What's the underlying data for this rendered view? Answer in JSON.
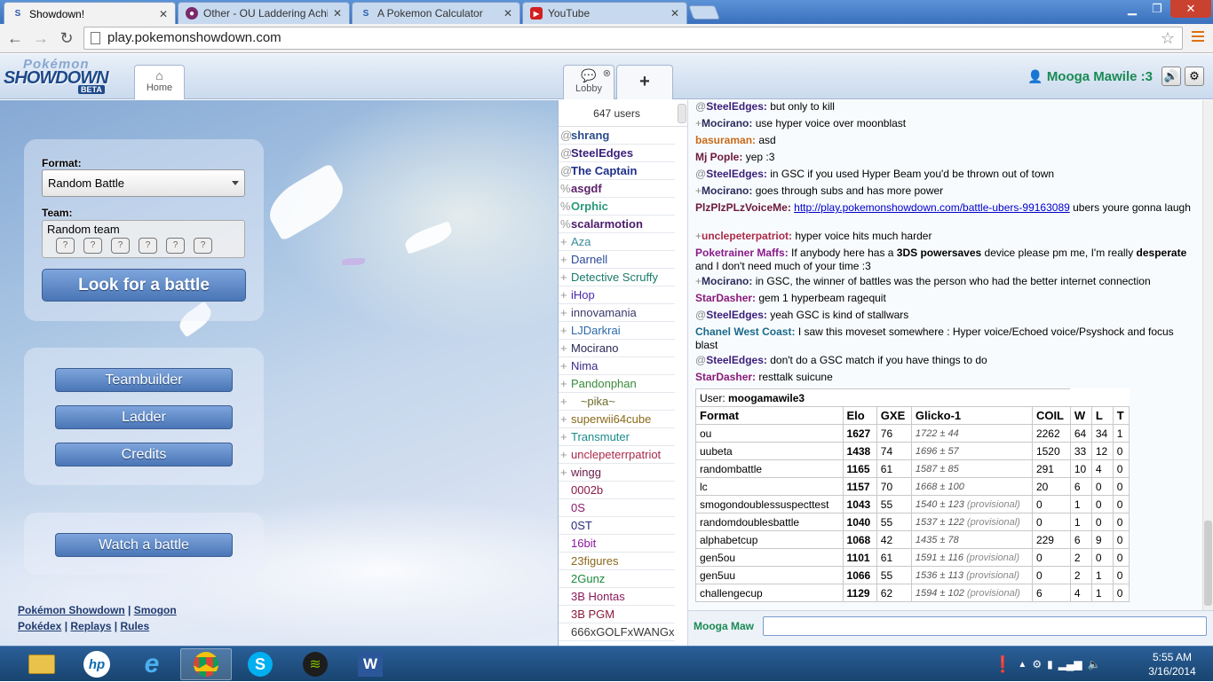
{
  "browser": {
    "tabs": [
      {
        "label": "Showdown!",
        "icon": "ps-favicon",
        "active": true
      },
      {
        "label": "Other - OU Laddering Achi",
        "icon": "forum-favicon",
        "active": false
      },
      {
        "label": "A Pokemon Calculator",
        "icon": "ps-favicon",
        "active": false
      },
      {
        "label": "YouTube",
        "icon": "youtube-favicon",
        "active": false
      }
    ],
    "url": "play.pokemonshowdown.com"
  },
  "header": {
    "logo": {
      "line1": "Pokémon",
      "line2": "SHOWDOWN",
      "badge": "BETA"
    },
    "tabs": [
      {
        "label": "Home",
        "icon": "home-icon"
      },
      {
        "label": "Lobby",
        "icon": "chat-bubble-icon"
      }
    ],
    "new_tab_label": "+",
    "username": "Mooga Mawile :3"
  },
  "home": {
    "format_label": "Format:",
    "format_value": "Random Battle",
    "team_label": "Team:",
    "team_value": "Random team",
    "look_button": "Look for a battle",
    "teambuilder_button": "Teambuilder",
    "ladder_button": "Ladder",
    "credits_button": "Credits",
    "watch_button": "Watch a battle",
    "footer_links": [
      "Pokémon Showdown",
      "Smogon",
      "Pokédex",
      "Replays",
      "Rules"
    ]
  },
  "userlist": {
    "count": "647 users",
    "users": [
      {
        "rank": "@",
        "name": "shrang",
        "color": "#2b4c8a",
        "bold": true
      },
      {
        "rank": "@",
        "name": "SteelEdges",
        "color": "#3a1f7a",
        "bold": true
      },
      {
        "rank": "@",
        "name": "The Captain",
        "color": "#1f2f8a",
        "bold": true
      },
      {
        "rank": "%",
        "name": "asgdf",
        "color": "#5a1f6a",
        "bold": true
      },
      {
        "rank": "%",
        "name": "Orphic",
        "color": "#2a9a7a",
        "bold": true
      },
      {
        "rank": "%",
        "name": "scalarmotion",
        "color": "#4a1a6a",
        "bold": true
      },
      {
        "rank": "+",
        "name": "Aza",
        "color": "#3a8a9a",
        "bold": false
      },
      {
        "rank": "+",
        "name": "Darnell",
        "color": "#2a4a9a",
        "bold": false
      },
      {
        "rank": "+",
        "name": "Detective Scruffy",
        "color": "#1a7a6a",
        "bold": false
      },
      {
        "rank": "+",
        "name": "iHop",
        "color": "#4a2aaa",
        "bold": false
      },
      {
        "rank": "+",
        "name": "innovamania",
        "color": "#3a3a6a",
        "bold": false
      },
      {
        "rank": "+",
        "name": "LJDarkrai",
        "color": "#2a6aaa",
        "bold": false
      },
      {
        "rank": "+",
        "name": "Mocirano",
        "color": "#2a2a5a",
        "bold": false
      },
      {
        "rank": "+",
        "name": "Nima",
        "color": "#3a2a8a",
        "bold": false
      },
      {
        "rank": "+",
        "name": "Pandonphan",
        "color": "#3a8a3a",
        "bold": false
      },
      {
        "rank": "+",
        "name": "   ~pika~",
        "color": "#6a6a2a",
        "bold": false
      },
      {
        "rank": "+",
        "name": "superwii64cube",
        "color": "#8a6a1a",
        "bold": false
      },
      {
        "rank": "+",
        "name": "Transmuter",
        "color": "#1a8a8a",
        "bold": false
      },
      {
        "rank": "+",
        "name": "unclepeterrpatriot",
        "color": "#aa2a4a",
        "bold": false
      },
      {
        "rank": "+",
        "name": "wingg",
        "color": "#6a1a4a",
        "bold": false
      },
      {
        "rank": "",
        "name": "0002b",
        "color": "#8a1a4a",
        "bold": false
      },
      {
        "rank": "",
        "name": "0S",
        "color": "#8a1a6a",
        "bold": false
      },
      {
        "rank": "",
        "name": "0ST",
        "color": "#2a2a7a",
        "bold": false
      },
      {
        "rank": "",
        "name": "16bit",
        "color": "#8a1a9a",
        "bold": false
      },
      {
        "rank": "",
        "name": "23figures",
        "color": "#8a6a1a",
        "bold": false
      },
      {
        "rank": "",
        "name": "2Gunz",
        "color": "#1a8a3a",
        "bold": false
      },
      {
        "rank": "",
        "name": "3B Hontas",
        "color": "#8a1a5a",
        "bold": false
      },
      {
        "rank": "",
        "name": "3B PGM",
        "color": "#8a1a3a",
        "bold": false
      },
      {
        "rank": "",
        "name": "666xGOLFxWANGx",
        "color": "#3a3a3a",
        "bold": false
      }
    ]
  },
  "chat": {
    "messages": [
      {
        "rank": "@",
        "user": "SteelEdges",
        "color": "#3a1f7a",
        "text": "but only to kill"
      },
      {
        "rank": "+",
        "user": "Mocirano",
        "color": "#2a2a5a",
        "text": "use hyper voice over moonblast"
      },
      {
        "rank": "",
        "user": "basuraman",
        "color": "#c86a1a",
        "text": "asd"
      },
      {
        "rank": "",
        "user": "Mj Pople",
        "color": "#6a1a3a",
        "text": "yep :3"
      },
      {
        "rank": "@",
        "user": "SteelEdges",
        "color": "#3a1f7a",
        "text": "in GSC if you used Hyper Beam you'd be thrown out of town"
      },
      {
        "rank": "+",
        "user": "Mocirano",
        "color": "#2a2a5a",
        "text": "goes through subs and has more power"
      },
      {
        "rank": "",
        "user": "PlzPlzPLzVoiceMe",
        "color": "#6a1a3a",
        "link": "http://play.pokemonshowdown.com/battle-ubers-99163089",
        "text": " ubers youre gonna laugh"
      },
      {
        "rank": "+",
        "user": "unclepeterpatriot",
        "color": "#aa2a4a",
        "text": "hyper voice hits much harder"
      },
      {
        "rank": "",
        "user": "Poketrainer Maffs",
        "color": "#8a1a8a",
        "text_parts": [
          "If anybody here has a ",
          "3DS powersaves",
          " device please pm me, I'm really ",
          "desperate",
          " and I don't need much of your time :3"
        ]
      },
      {
        "rank": "+",
        "user": "Mocirano",
        "color": "#2a2a5a",
        "text": "in GSC, the winner of battles was the person who had the better internet connection"
      },
      {
        "rank": "",
        "user": "StarDasher",
        "color": "#8a1a7a",
        "text": "gem 1 hyperbeam ragequit"
      },
      {
        "rank": "@",
        "user": "SteelEdges",
        "color": "#3a1f7a",
        "text": "yeah GSC is kind of stallwars"
      },
      {
        "rank": "",
        "user": "Chanel West Coast",
        "color": "#1a6a8a",
        "text": "I saw this moveset somewhere : Hyper voice/Echoed voice/Psyshock and focus blast"
      },
      {
        "rank": "@",
        "user": "SteelEdges",
        "color": "#3a1f7a",
        "text": "don't do a GSC match if you have things to do"
      },
      {
        "rank": "",
        "user": "StarDasher",
        "color": "#8a1a7a",
        "text": "resttalk suicune"
      }
    ],
    "rank_table": {
      "caption_label": "User: ",
      "caption_user": "moogamawile3",
      "headers": [
        "Format",
        "Elo",
        "GXE",
        "Glicko-1",
        "COIL",
        "W",
        "L",
        "T"
      ],
      "rows": [
        {
          "format": "ou",
          "elo": "1627",
          "gxe": "76",
          "glicko": "1722 ± 44",
          "prov": "",
          "coil": "2262",
          "w": "64",
          "l": "34",
          "t": "1"
        },
        {
          "format": "uubeta",
          "elo": "1438",
          "gxe": "74",
          "glicko": "1696 ± 57",
          "prov": "",
          "coil": "1520",
          "w": "33",
          "l": "12",
          "t": "0"
        },
        {
          "format": "randombattle",
          "elo": "1165",
          "gxe": "61",
          "glicko": "1587 ± 85",
          "prov": "",
          "coil": "291",
          "w": "10",
          "l": "4",
          "t": "0"
        },
        {
          "format": "lc",
          "elo": "1157",
          "gxe": "70",
          "glicko": "1668 ± 100",
          "prov": "",
          "coil": "20",
          "w": "6",
          "l": "0",
          "t": "0"
        },
        {
          "format": "smogondoublessuspecttest",
          "elo": "1043",
          "gxe": "55",
          "glicko": "1540 ± 123",
          "prov": "(provisional)",
          "coil": "0",
          "w": "1",
          "l": "0",
          "t": "0"
        },
        {
          "format": "randomdoublesbattle",
          "elo": "1040",
          "gxe": "55",
          "glicko": "1537 ± 122",
          "prov": "(provisional)",
          "coil": "0",
          "w": "1",
          "l": "0",
          "t": "0"
        },
        {
          "format": "alphabetcup",
          "elo": "1068",
          "gxe": "42",
          "glicko": "1435 ± 78",
          "prov": "",
          "coil": "229",
          "w": "6",
          "l": "9",
          "t": "0"
        },
        {
          "format": "gen5ou",
          "elo": "1101",
          "gxe": "61",
          "glicko": "1591 ± 116",
          "prov": "(provisional)",
          "coil": "0",
          "w": "2",
          "l": "0",
          "t": "0"
        },
        {
          "format": "gen5uu",
          "elo": "1066",
          "gxe": "55",
          "glicko": "1536 ± 113",
          "prov": "(provisional)",
          "coil": "0",
          "w": "2",
          "l": "1",
          "t": "0"
        },
        {
          "format": "challengecup",
          "elo": "1129",
          "gxe": "62",
          "glicko": "1594 ± 102",
          "prov": "(provisional)",
          "coil": "6",
          "w": "4",
          "l": "1",
          "t": "0"
        }
      ]
    },
    "input_name": "Mooga Maw"
  },
  "taskbar": {
    "apps": [
      "file-explorer-icon",
      "hp-icon",
      "internet-explorer-icon",
      "chrome-icon",
      "skype-icon",
      "spotify-icon",
      "word-icon"
    ],
    "time": "5:55 AM",
    "date": "3/16/2014"
  }
}
